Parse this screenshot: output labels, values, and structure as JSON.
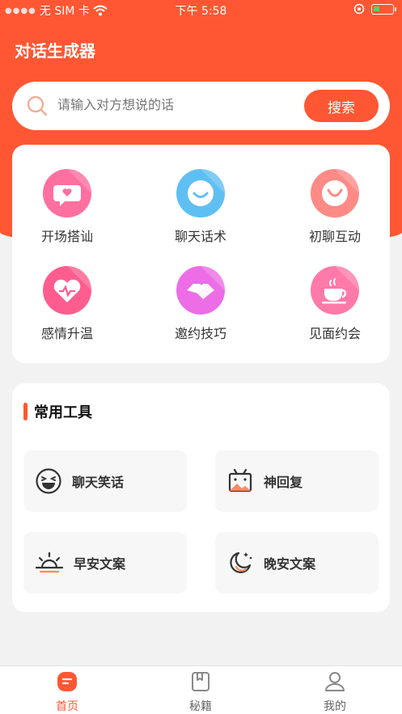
{
  "status_bar": {
    "carrier": "无 SIM 卡",
    "time": "下午 5:58"
  },
  "header": {
    "title": "对话生成器"
  },
  "search": {
    "placeholder": "请输入对方想说的话",
    "button_label": "搜索"
  },
  "categories": [
    {
      "label": "开场搭讪",
      "icon": "chat-heart-icon",
      "color": "#ff6fa0"
    },
    {
      "label": "聊天话术",
      "icon": "smile-bubble-icon",
      "color": "#5fbff3"
    },
    {
      "label": "初聊互动",
      "icon": "smile-face-icon",
      "color": "#ff8a86"
    },
    {
      "label": "感情升温",
      "icon": "heart-pulse-icon",
      "color": "#ff5d8f"
    },
    {
      "label": "邀约技巧",
      "icon": "handshake-icon",
      "color": "#ec6de6"
    },
    {
      "label": "见面约会",
      "icon": "coffee-cup-icon",
      "color": "#ff7aa8"
    }
  ],
  "tools": {
    "title": "常用工具",
    "items": [
      {
        "label": "聊天笑话",
        "icon": "laughing-face-icon"
      },
      {
        "label": "神回复",
        "icon": "tv-icon"
      },
      {
        "label": "早安文案",
        "icon": "sunrise-icon"
      },
      {
        "label": "晚安文案",
        "icon": "moon-icon"
      }
    ]
  },
  "tabbar": {
    "items": [
      {
        "label": "首页",
        "icon": "home-icon",
        "active": true
      },
      {
        "label": "秘籍",
        "icon": "book-icon",
        "active": false
      },
      {
        "label": "我的",
        "icon": "user-icon",
        "active": false
      }
    ]
  },
  "colors": {
    "accent": "#ff5733",
    "background": "#f2f2f2"
  }
}
